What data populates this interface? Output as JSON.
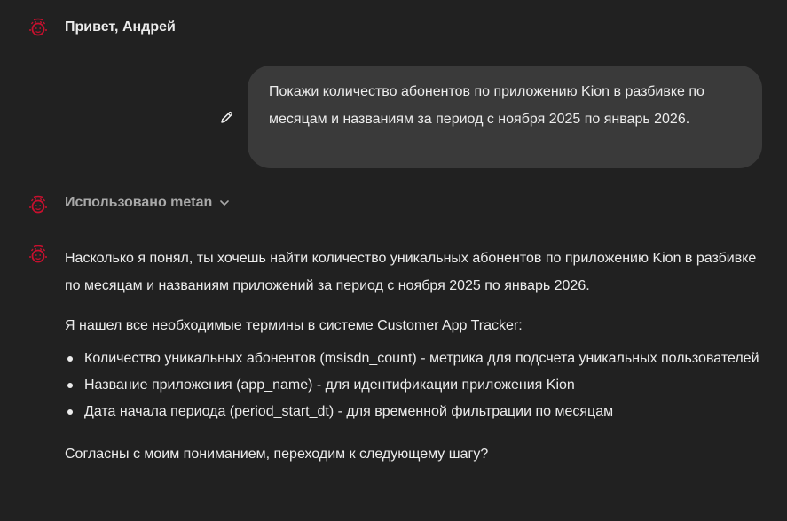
{
  "greeting": {
    "text": "Привет, Андрей"
  },
  "user_message": {
    "text": "Покажи количество абонентов по приложению Kion в разбивке по месяцам и названиям за период с ноября 2025 по январь 2026."
  },
  "tool_usage": {
    "label": "Использовано metan"
  },
  "assistant_message": {
    "intro": "Насколько я понял, ты хочешь найти количество уникальных абонентов по приложению Kion в разбивке по месяцам и названиям приложений за период с ноября 2025 по январь 2026.",
    "terms_intro": "Я нашел все необходимые термины в системе Customer App Tracker:",
    "terms": [
      "Количество уникальных абонентов (msisdn_count) - метрика для подсчета уникальных пользователей",
      "Название приложения (app_name) - для идентификации приложения Kion",
      "Дата начала периода (period_start_dt) - для временной фильтрации по месяцам"
    ],
    "question": "Согласны с моим пониманием, переходим к следующему шагу?"
  },
  "colors": {
    "background": "#212121",
    "bubble": "#3a3a3a",
    "text": "#ececec",
    "muted_text": "#a9a9a9",
    "avatar_accent": "#c8102e"
  },
  "icons": {
    "assistant_avatar": "assistant-logo-icon",
    "edit": "pencil-icon",
    "expand": "chevron-down-icon"
  }
}
